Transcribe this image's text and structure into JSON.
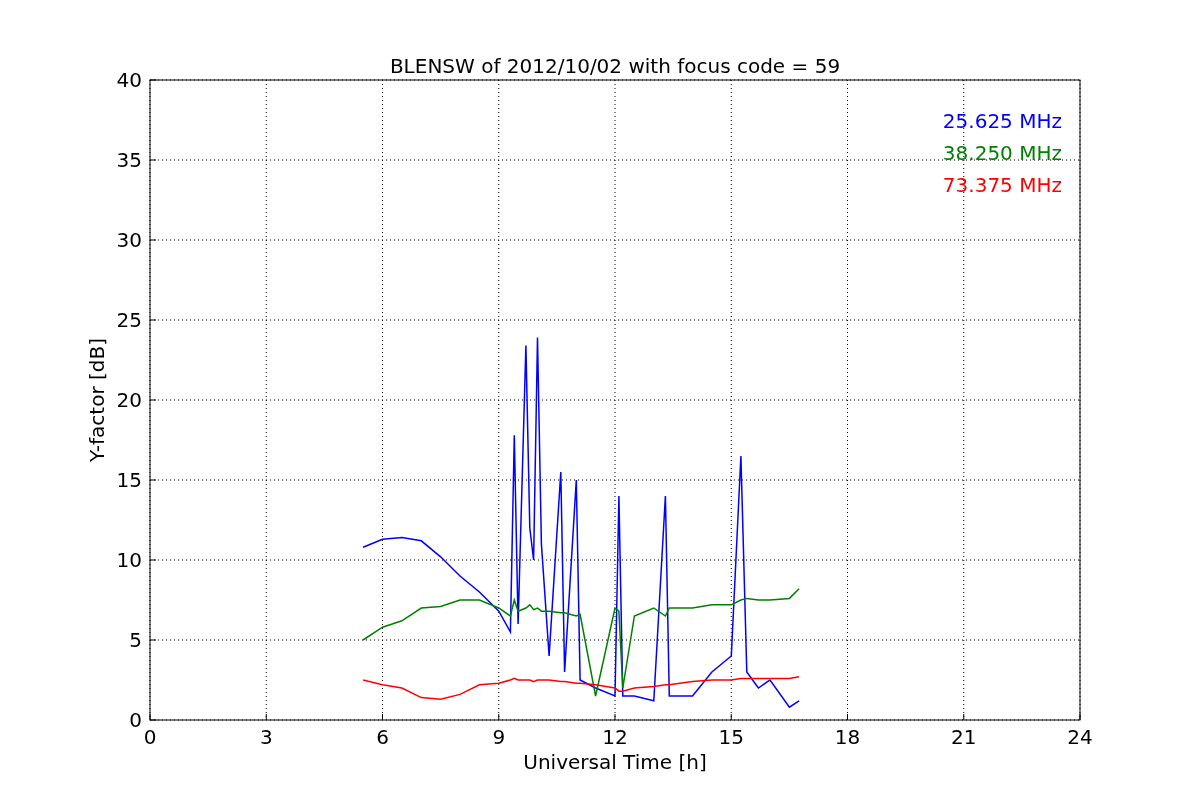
{
  "chart_data": {
    "type": "line",
    "title": "BLENSW of 2012/10/02 with focus code = 59",
    "xlabel": "Universal Time [h]",
    "ylabel": "Y-factor [dB]",
    "x": [
      5.5,
      6,
      6.5,
      7,
      7.5,
      8,
      8.5,
      9,
      9.3,
      9.4,
      9.5,
      9.7,
      9.8,
      9.9,
      10.0,
      10.1,
      10.3,
      10.6,
      10.7,
      11.0,
      11.1,
      11.5,
      12.0,
      12.1,
      12.2,
      12.5,
      13.0,
      13.3,
      13.4,
      14,
      14.5,
      15,
      15.25,
      15.4,
      15.7,
      16,
      16.5,
      16.75
    ],
    "series": [
      {
        "name": "25.625 MHz",
        "color": "#0000ff",
        "values": [
          10.8,
          11.3,
          11.4,
          11.2,
          10.2,
          9.0,
          8.0,
          6.8,
          5.5,
          17.8,
          6,
          23.4,
          12,
          10,
          23.9,
          11,
          4,
          15.5,
          3,
          15,
          2.5,
          2,
          1.5,
          14,
          1.5,
          1.5,
          1.2,
          14,
          1.5,
          1.5,
          3,
          4,
          16.5,
          3,
          2,
          2.5,
          0.8,
          1.2
        ]
      },
      {
        "name": "38.250 MHz",
        "color": "#008000",
        "values": [
          5,
          5.8,
          6.2,
          7.0,
          7.1,
          7.5,
          7.5,
          7.0,
          6.5,
          7.5,
          6.8,
          7,
          7.2,
          6.9,
          7,
          6.8,
          6.8,
          6.7,
          6.7,
          6.5,
          6.6,
          1.5,
          7.0,
          6.8,
          2,
          6.5,
          7,
          6.5,
          7,
          7.0,
          7.2,
          7.2,
          7.5,
          7.6,
          7.5,
          7.5,
          7.6,
          8.2
        ]
      },
      {
        "name": "73.375 MHz",
        "color": "#ff0000",
        "values": [
          2.5,
          2.2,
          2.0,
          1.4,
          1.3,
          1.6,
          2.2,
          2.3,
          2.5,
          2.6,
          2.5,
          2.5,
          2.5,
          2.4,
          2.5,
          2.5,
          2.5,
          2.4,
          2.4,
          2.3,
          2.3,
          2.2,
          2.0,
          1.8,
          1.8,
          2.0,
          2.1,
          2.2,
          2.2,
          2.4,
          2.5,
          2.5,
          2.6,
          2.6,
          2.6,
          2.6,
          2.6,
          2.7
        ]
      }
    ],
    "xlim": [
      0,
      24
    ],
    "ylim": [
      0,
      40
    ],
    "xticks": [
      0,
      3,
      6,
      9,
      12,
      15,
      18,
      21,
      24
    ],
    "yticks": [
      0,
      5,
      10,
      15,
      20,
      25,
      30,
      35,
      40
    ],
    "grid": true
  }
}
